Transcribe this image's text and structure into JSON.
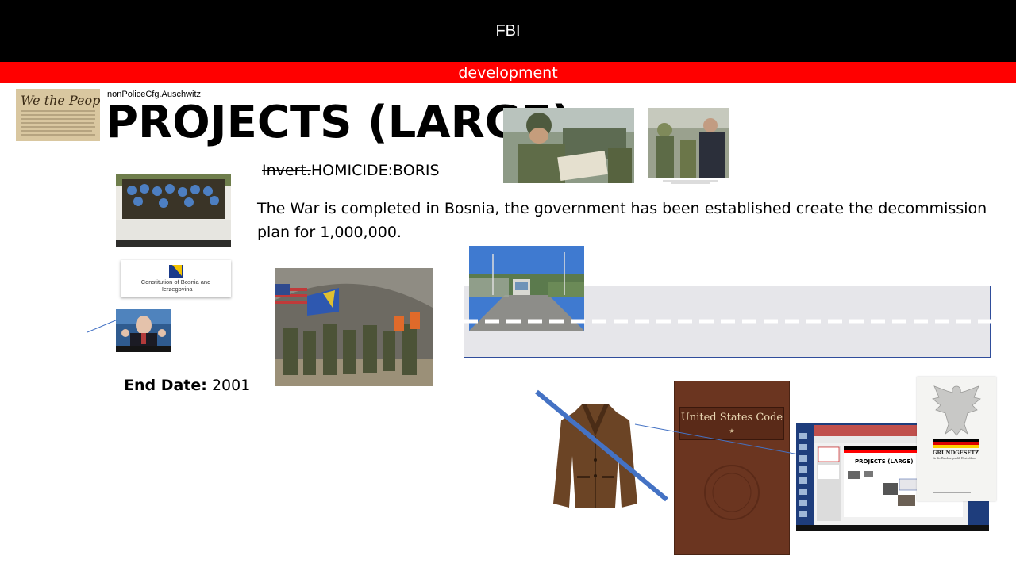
{
  "header": {
    "title": "FBI"
  },
  "banner": {
    "label": "development"
  },
  "slide": {
    "subtitle": "nonPoliceCfg.Auschwitz",
    "title": "PROJECTS (LARGE)",
    "homicide_struck": "Invert.",
    "homicide_rest": "HOMICIDE:BORIS",
    "body": "The War is completed in Bosnia, the government has been established create the decommission plan for 1,000,000.",
    "end_date_label": "End Date:",
    "end_date_value": "2001"
  },
  "images": {
    "constitution_card": "Constitution of Bosnia and Herzegovina",
    "us_code_title": "United States Code",
    "grundgesetz_title": "GRUNDGESETZ",
    "grundgesetz_sub": "für die Bundesrepublik Deutschland",
    "screenshot_title": "PROJECTS (LARGE)"
  },
  "colors": {
    "topbar": "#000000",
    "banner": "#ff0000",
    "highlight_box": "#e6e6ea",
    "highlight_border": "#2f4d9b",
    "slash_line": "#4472c4"
  }
}
